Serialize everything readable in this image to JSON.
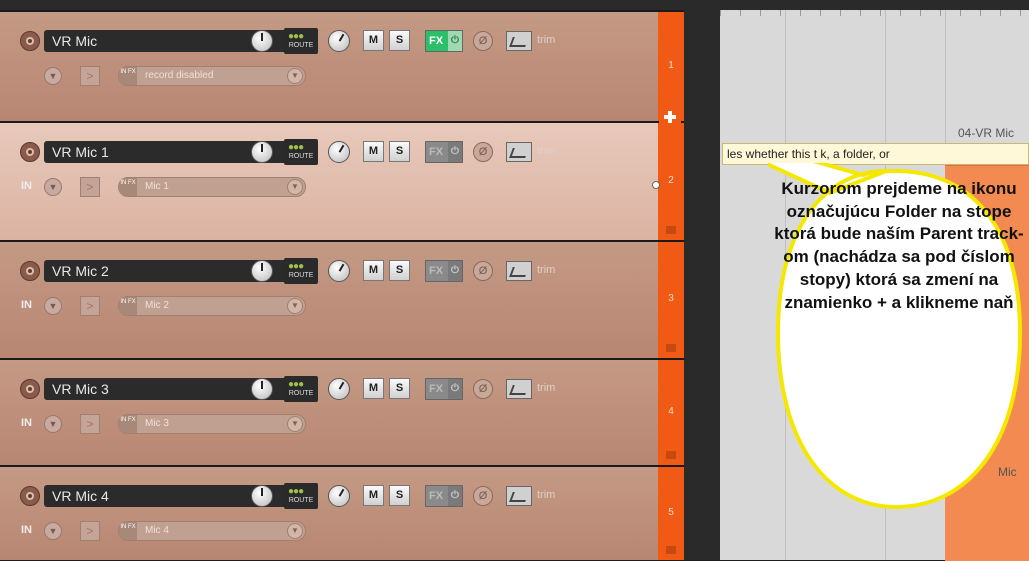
{
  "tracks": [
    {
      "name": "VR Mic",
      "number": "1",
      "input_label": "",
      "input_text": "record disabled",
      "fx_on": true
    },
    {
      "name": "VR Mic 1",
      "number": "2",
      "input_label": "IN",
      "input_text": "Mic 1",
      "fx_on": false
    },
    {
      "name": "VR Mic 2",
      "number": "3",
      "input_label": "IN",
      "input_text": "Mic 2",
      "fx_on": false
    },
    {
      "name": "VR Mic 3",
      "number": "4",
      "input_label": "IN",
      "input_text": "Mic 3",
      "fx_on": false
    },
    {
      "name": "VR Mic 4",
      "number": "5",
      "input_label": "IN",
      "input_text": "Mic 4",
      "fx_on": false
    }
  ],
  "buttons": {
    "route": "ROUTE",
    "mute": "M",
    "solo": "S",
    "fx": "FX",
    "trim": "trim",
    "in_fx": "IN FX",
    "phase_symbol": "Ø",
    "power_symbol": "⏻"
  },
  "tooltip": "les whether this t           k, a folder, or",
  "arrange_labels": {
    "item_04": "04-VR Mic",
    "item_mic": "Mic"
  },
  "callout": {
    "text": "Kurzorom prejdeme na ikonu označujúcu Folder na stope ktorá bude naším Parent track-om (nachádza sa pod číslom stopy) ktorá sa zmení na znamienko + a klikneme naň"
  },
  "colors": {
    "track_number_bg": "#f05a14",
    "fx_on": "#2cbf6a",
    "callout_fill": "#ffffff",
    "callout_border": "#f5e800"
  },
  "icons": [
    "record-arm-icon",
    "dropdown-icon",
    "folder-plus-icon",
    "envelope-icon",
    "phase-icon",
    "power-icon"
  ]
}
